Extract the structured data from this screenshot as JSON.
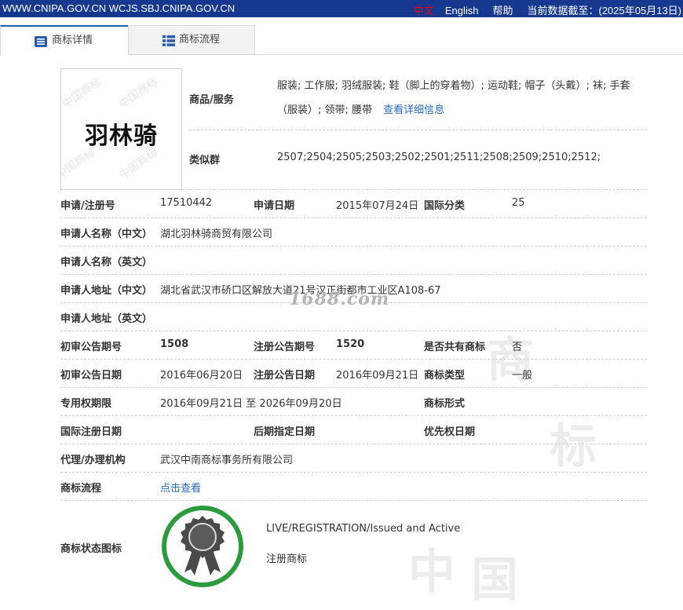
{
  "topbar": {
    "domains": "WWW.CNIPA.GOV.CN WCJS.SBJ.CNIPA.GOV.CN",
    "lang_cn": "中文",
    "lang_en": "English",
    "help": "帮助",
    "data_date": "当前数据截至：(2025年05月13日)"
  },
  "tabs": [
    {
      "label": "商标详情",
      "icon": "detail-list-icon",
      "active": true
    },
    {
      "label": "商标流程",
      "icon": "list-icon",
      "active": false
    }
  ],
  "trademark": {
    "word": "羽林骑",
    "watermark": "中国商标"
  },
  "goods": {
    "label": "商品/服务",
    "value": "服装; 工作服; 羽绒服装; 鞋（脚上的穿着物）; 运动鞋; 帽子（头戴）; 袜; 手套（服装）; 领带; 腰带",
    "link": "查看详细信息"
  },
  "similar_group": {
    "label": "类似群",
    "value": "2507;2504;2505;2503;2502;2501;2511;2508;2509;2510;2512;"
  },
  "fields": {
    "reg_no_label": "申请/注册号",
    "reg_no": "17510442",
    "apply_date_label": "申请日期",
    "apply_date": "2015年07月24日",
    "intl_class_label": "国际分类",
    "intl_class": "25",
    "applicant_cn_label": "申请人名称（中文）",
    "applicant_cn": "湖北羽林骑商贸有限公司",
    "applicant_en_label": "申请人名称（英文）",
    "applicant_en": "",
    "address_cn_label": "申请人地址（中文）",
    "address_cn": "湖北省武汉市硚口区解放大道21号汉正街都市工业区A108-67",
    "address_en_label": "申请人地址（英文）",
    "address_en": "",
    "prelim_no_label": "初审公告期号",
    "prelim_no": "1508",
    "reg_pub_no_label": "注册公告期号",
    "reg_pub_no": "1520",
    "shared_label": "是否共有商标",
    "shared": "否",
    "prelim_date_label": "初审公告日期",
    "prelim_date": "2016年06月20日",
    "reg_pub_date_label": "注册公告日期",
    "reg_pub_date": "2016年09月21日",
    "tm_type_label": "商标类型",
    "tm_type": "一般",
    "term_label": "专用权期限",
    "term": "2016年09月21日 至 2026年09月20日",
    "tm_form_label": "商标形式",
    "tm_form": "",
    "intl_reg_date_label": "国际注册日期",
    "intl_reg_date": "",
    "later_desig_label": "后期指定日期",
    "later_desig": "",
    "priority_label": "优先权日期",
    "priority": "",
    "agent_label": "代理/办理机构",
    "agent": "武汉中南商标事务所有限公司",
    "flow_label": "商标流程",
    "flow_link": "点击查看",
    "status_label": "商标状态图标",
    "status_en": "LIVE/REGISTRATION/Issued and Active",
    "status_cn": "注册商标"
  },
  "watermark_site": "1688.com",
  "colors": {
    "topbar": "#16398f",
    "link": "#2a6ab8",
    "badge_ring": "#2e9a3e",
    "badge_medal": "#4a4a4a"
  }
}
